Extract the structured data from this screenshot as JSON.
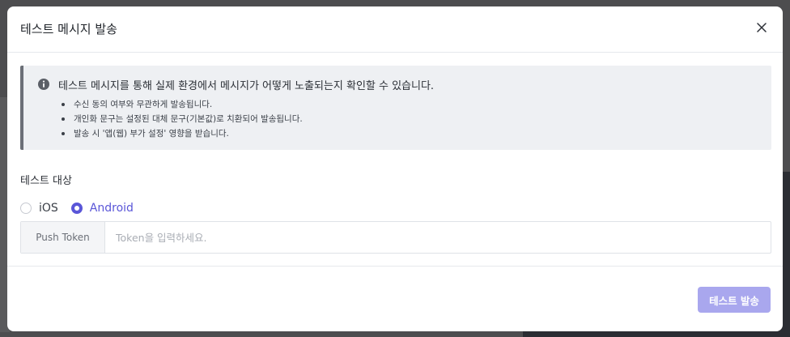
{
  "modal": {
    "title": "테스트 메시지 발송",
    "close_icon": "close-icon"
  },
  "notice": {
    "icon": "info-icon",
    "heading": "테스트 메시지를 통해 실제 환경에서 메시지가 어떻게 노출되는지 확인할 수 있습니다.",
    "items": [
      "수신 동의 여부와 무관하게 발송됩니다.",
      "개인화 문구는 설정된 대체 문구(기본값)로 치환되어 발송됩니다.",
      "발송 시 '앱(웹) 부가 설정' 영향을 받습니다."
    ]
  },
  "target": {
    "label": "테스트 대상",
    "options": [
      {
        "label": "iOS",
        "checked": false
      },
      {
        "label": "Android",
        "checked": true
      }
    ]
  },
  "token": {
    "label": "Push Token",
    "placeholder": "Token을 입력하세요.",
    "value": ""
  },
  "footer": {
    "send_label": "테스트 발송"
  },
  "colors": {
    "accent": "#5a56d8",
    "button_disabled": "#a9a7ee",
    "notice_bg": "#eef0f3"
  }
}
